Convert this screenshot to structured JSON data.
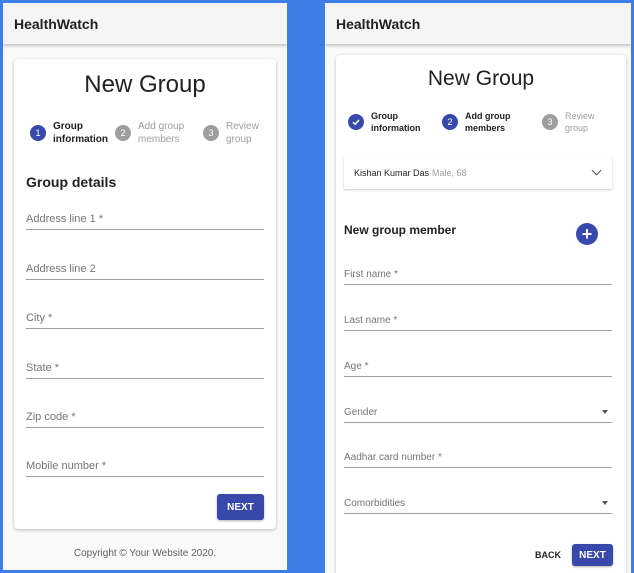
{
  "app": {
    "title": "HealthWatch"
  },
  "left": {
    "page_title": "New Group",
    "steps": [
      {
        "number": "1",
        "label_line1": "Group",
        "label_line2": "information"
      },
      {
        "number": "2",
        "label_line1": "Add group",
        "label_line2": "members"
      },
      {
        "number": "3",
        "label_line1": "Review",
        "label_line2": "group"
      }
    ],
    "section_title": "Group details",
    "fields": [
      {
        "label": "Address line 1 *"
      },
      {
        "label": "Address line 2"
      },
      {
        "label": "City *"
      },
      {
        "label": "State *"
      },
      {
        "label": "Zip code *"
      },
      {
        "label": "Mobile number *"
      }
    ],
    "next_label": "NEXT",
    "footer": "Copyright © Your Website 2020."
  },
  "right": {
    "page_title": "New Group",
    "steps": [
      {
        "number": "",
        "label_line1": "Group",
        "label_line2": "information"
      },
      {
        "number": "2",
        "label_line1": "Add group",
        "label_line2": "members"
      },
      {
        "number": "3",
        "label_line1": "Review",
        "label_line2": "group"
      }
    ],
    "member": {
      "name": "Kishan Kumar Das",
      "meta": "Male, 68"
    },
    "section_title": "New group member",
    "fields": [
      {
        "label": "First name *"
      },
      {
        "label": "Last name *"
      },
      {
        "label": "Age *"
      },
      {
        "label": "Gender"
      },
      {
        "label": "Aadhar card number *"
      },
      {
        "label": "Comorbidities"
      }
    ],
    "add_icon": "+",
    "back_label": "BACK",
    "next_label": "NEXT"
  },
  "colors": {
    "accent": "#3949ab",
    "frame": "#3d7fe6",
    "inactive_step": "#9e9e9e"
  }
}
